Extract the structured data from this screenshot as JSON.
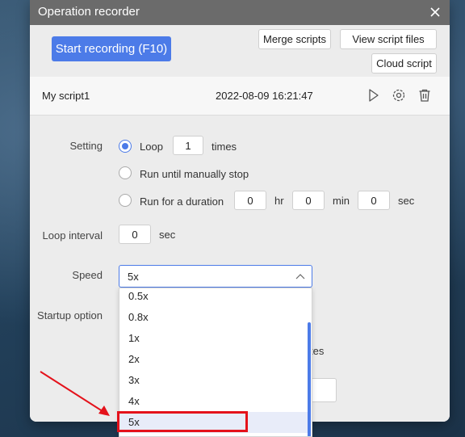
{
  "window": {
    "title": "Operation recorder"
  },
  "toolbar": {
    "start_label": "Start recording (F10)",
    "merge_label": "Merge scripts",
    "view_label": "View script files",
    "cloud_label": "Cloud script"
  },
  "script": {
    "name": "My script1",
    "date": "2022-08-09 16:21:47"
  },
  "settings": {
    "setting_label": "Setting",
    "loop_label": "Loop",
    "loop_count": "1",
    "times_label": "times",
    "manual_label": "Run until manually stop",
    "duration_label": "Run for a duration",
    "hr_value": "0",
    "hr_label": "hr",
    "min_value": "0",
    "min_label": "min",
    "sec_value": "0",
    "sec_label": "sec",
    "interval_label": "Loop interval",
    "interval_value": "0",
    "interval_unit": "sec",
    "speed_label": "Speed",
    "speed_value": "5x",
    "startup_label": "Startup option",
    "partial_text": "tes"
  },
  "speed_options": [
    "0.5x",
    "0.8x",
    "1x",
    "2x",
    "3x",
    "4x",
    "5x"
  ],
  "colors": {
    "accent": "#4c7be8",
    "highlight": "#e4121b",
    "titlebar": "#6b6b6b"
  }
}
